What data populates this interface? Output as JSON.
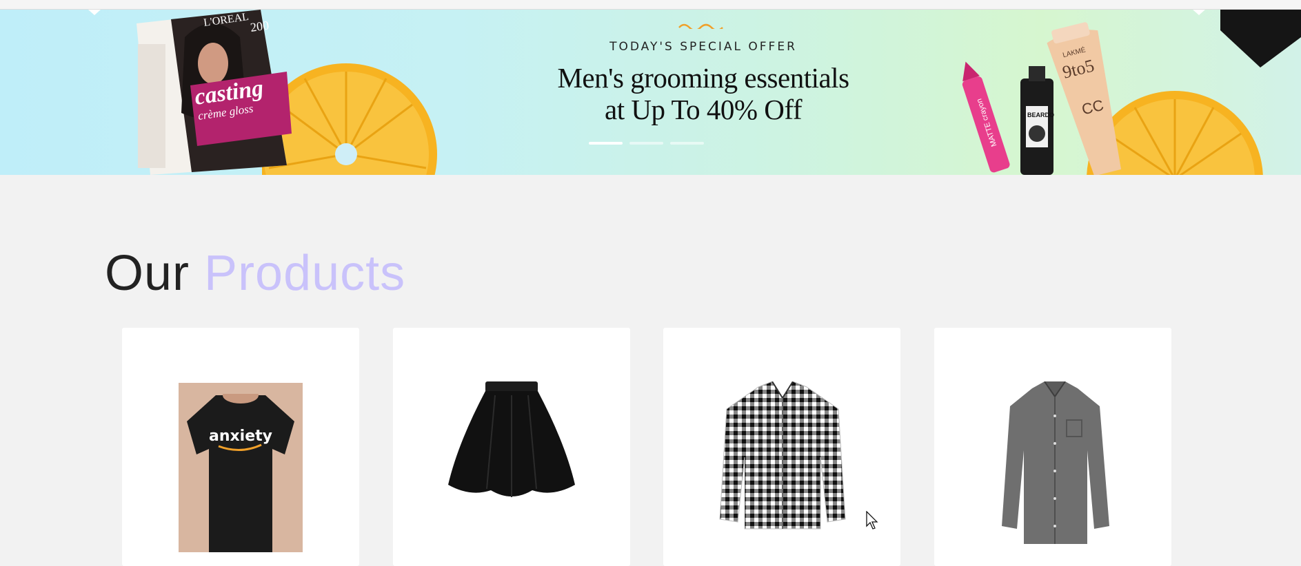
{
  "banner": {
    "eyebrow": "TODAY'S SPECIAL OFFER",
    "headline_line1": "Men's grooming essentials",
    "headline_line2": "at Up To 40% Off",
    "slides": [
      {
        "active": true
      },
      {
        "active": false
      },
      {
        "active": false
      }
    ],
    "left_product": {
      "brand": "L'OREAL",
      "name": "casting",
      "sub": "crème gloss",
      "shade": "200"
    },
    "right_products": {
      "lipstick": "MATTE crayon",
      "beardo": "BEARDO",
      "cream_brand": "LAKMÉ",
      "cream_name": "9to5",
      "cream_cc": "CC"
    },
    "colors": {
      "accent_wave": "#f0a02a",
      "citrus": "#f7b321"
    }
  },
  "products_section": {
    "title_part1": "Our",
    "title_part2": "Products",
    "accent_color": "#c9c2fb"
  },
  "products": [
    {
      "name": "t-shirt",
      "print_text": "anxiety"
    },
    {
      "name": "skirt"
    },
    {
      "name": "checked-shirt"
    },
    {
      "name": "grey-shirt"
    }
  ]
}
